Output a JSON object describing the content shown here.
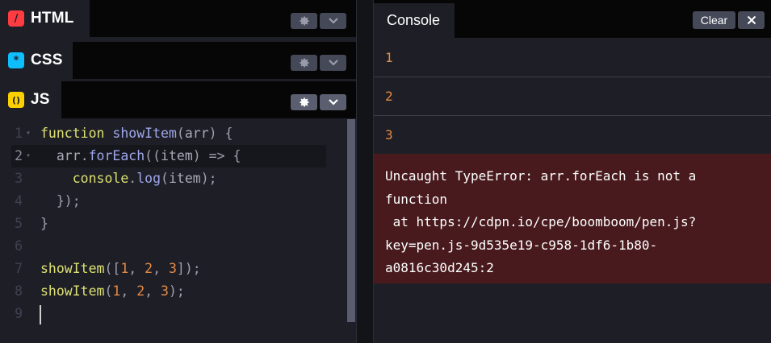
{
  "panels": [
    {
      "label": "HTML",
      "badge": "/",
      "badge_bg": "#ff3c41",
      "badge_fg": "#1e1f26"
    },
    {
      "label": "CSS",
      "badge": "*",
      "badge_bg": "#0ebeff",
      "badge_fg": "#1e1f26"
    },
    {
      "label": "JS",
      "badge": "()",
      "badge_bg": "#fcd000",
      "badge_fg": "#1e1f26"
    }
  ],
  "icons": {
    "settings": "gear-icon",
    "collapse": "chevron-down-icon",
    "close": "close-icon"
  },
  "editor": {
    "line_numbers": [
      "1",
      "2",
      "3",
      "4",
      "5",
      "6",
      "7",
      "8",
      "9"
    ],
    "active_line": 2,
    "lines": [
      {
        "indent": "",
        "tokens": [
          [
            "kw",
            "function"
          ],
          [
            "",
            ""
          ],
          [
            "fn",
            "showItem"
          ],
          [
            "op",
            "("
          ],
          [
            "pr",
            "arr"
          ],
          [
            "op",
            ")"
          ],
          [
            "",
            ""
          ],
          [
            "op",
            "{"
          ]
        ]
      },
      {
        "indent": "  ",
        "tokens": [
          [
            "pr",
            "arr"
          ],
          [
            "op",
            "."
          ],
          [
            "fn",
            "forEach"
          ],
          [
            "op",
            "(("
          ],
          [
            "pr",
            "item"
          ],
          [
            "op",
            ")"
          ],
          [
            "",
            ""
          ],
          [
            "op",
            "=>"
          ],
          [
            "",
            ""
          ],
          [
            "op",
            "{"
          ]
        ]
      },
      {
        "indent": "    ",
        "tokens": [
          [
            "kw",
            "console"
          ],
          [
            "op",
            "."
          ],
          [
            "fn",
            "log"
          ],
          [
            "op",
            "("
          ],
          [
            "pr",
            "item"
          ],
          [
            "op",
            ");"
          ]
        ]
      },
      {
        "indent": "  ",
        "tokens": [
          [
            "op",
            "});"
          ]
        ]
      },
      {
        "indent": "",
        "tokens": [
          [
            "op",
            "}"
          ]
        ]
      },
      {
        "indent": "",
        "tokens": []
      },
      {
        "indent": "",
        "tokens": [
          [
            "kw",
            "showItem"
          ],
          [
            "op",
            "(["
          ],
          [
            "nm",
            "1"
          ],
          [
            "op",
            ","
          ],
          [
            "",
            ""
          ],
          [
            "nm",
            "2"
          ],
          [
            "op",
            ","
          ],
          [
            "",
            ""
          ],
          [
            "nm",
            "3"
          ],
          [
            "op",
            "]);"
          ]
        ]
      },
      {
        "indent": "",
        "tokens": [
          [
            "kw",
            "showItem"
          ],
          [
            "op",
            "("
          ],
          [
            "nm",
            "1"
          ],
          [
            "op",
            ","
          ],
          [
            "",
            ""
          ],
          [
            "nm",
            "2"
          ],
          [
            "op",
            ","
          ],
          [
            "",
            ""
          ],
          [
            "nm",
            "3"
          ],
          [
            "op",
            ");"
          ]
        ]
      },
      {
        "indent": "",
        "tokens": []
      }
    ]
  },
  "console": {
    "tab_label": "Console",
    "clear_label": "Clear",
    "logs": [
      "1",
      "2",
      "3"
    ],
    "error_lines": [
      "Uncaught TypeError: arr.forEach is not a",
      "function",
      " at https://cdpn.io/cpe/boomboom/pen.js?",
      "key=pen.js-9d535e19-c958-1df6-1b80-",
      "a0816c30d245:2"
    ]
  },
  "colors": {
    "accent_html": "#ff3c41",
    "accent_css": "#0ebeff",
    "accent_js": "#fcd000",
    "error_bg": "#481a1d",
    "log_number": "#e58a45"
  }
}
